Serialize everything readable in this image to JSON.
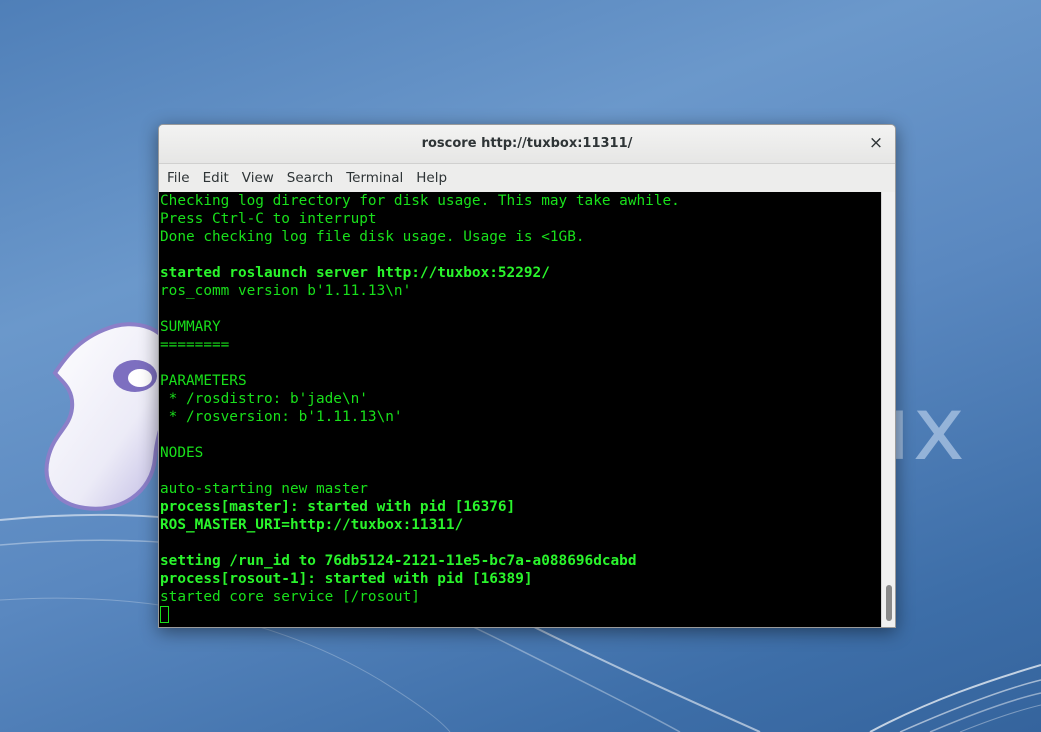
{
  "desktop": {
    "logo_text": "ux"
  },
  "window": {
    "title": "roscore http://tuxbox:11311/",
    "close_label": "×",
    "menu": [
      "File",
      "Edit",
      "View",
      "Search",
      "Terminal",
      "Help"
    ]
  },
  "terminal": {
    "lines": [
      {
        "text": "Checking log directory for disk usage. This may take awhile.",
        "bold": false
      },
      {
        "text": "Press Ctrl-C to interrupt",
        "bold": false
      },
      {
        "text": "Done checking log file disk usage. Usage is <1GB.",
        "bold": false
      },
      {
        "text": "",
        "bold": false
      },
      {
        "text": "started roslaunch server http://tuxbox:52292/",
        "bold": true
      },
      {
        "text": "ros_comm version b'1.11.13\\n'",
        "bold": false
      },
      {
        "text": "",
        "bold": false
      },
      {
        "text": "SUMMARY",
        "bold": false
      },
      {
        "text": "========",
        "bold": false
      },
      {
        "text": "",
        "bold": false
      },
      {
        "text": "PARAMETERS",
        "bold": false
      },
      {
        "text": " * /rosdistro: b'jade\\n'",
        "bold": false
      },
      {
        "text": " * /rosversion: b'1.11.13\\n'",
        "bold": false
      },
      {
        "text": "",
        "bold": false
      },
      {
        "text": "NODES",
        "bold": false
      },
      {
        "text": "",
        "bold": false
      },
      {
        "text": "auto-starting new master",
        "bold": false
      },
      {
        "text": "process[master]: started with pid [16376]",
        "bold": true
      },
      {
        "text": "ROS_MASTER_URI=http://tuxbox:11311/",
        "bold": true
      },
      {
        "text": "",
        "bold": false
      },
      {
        "text": "setting /run_id to 76db5124-2121-11e5-bc7a-a088696dcabd",
        "bold": true
      },
      {
        "text": "process[rosout-1]: started with pid [16389]",
        "bold": true
      },
      {
        "text": "started core service [/rosout]",
        "bold": false
      }
    ]
  },
  "colors": {
    "terminal_fg": "#19e01b",
    "terminal_bg": "#000000",
    "desktop_bg": "#5a88c0"
  }
}
